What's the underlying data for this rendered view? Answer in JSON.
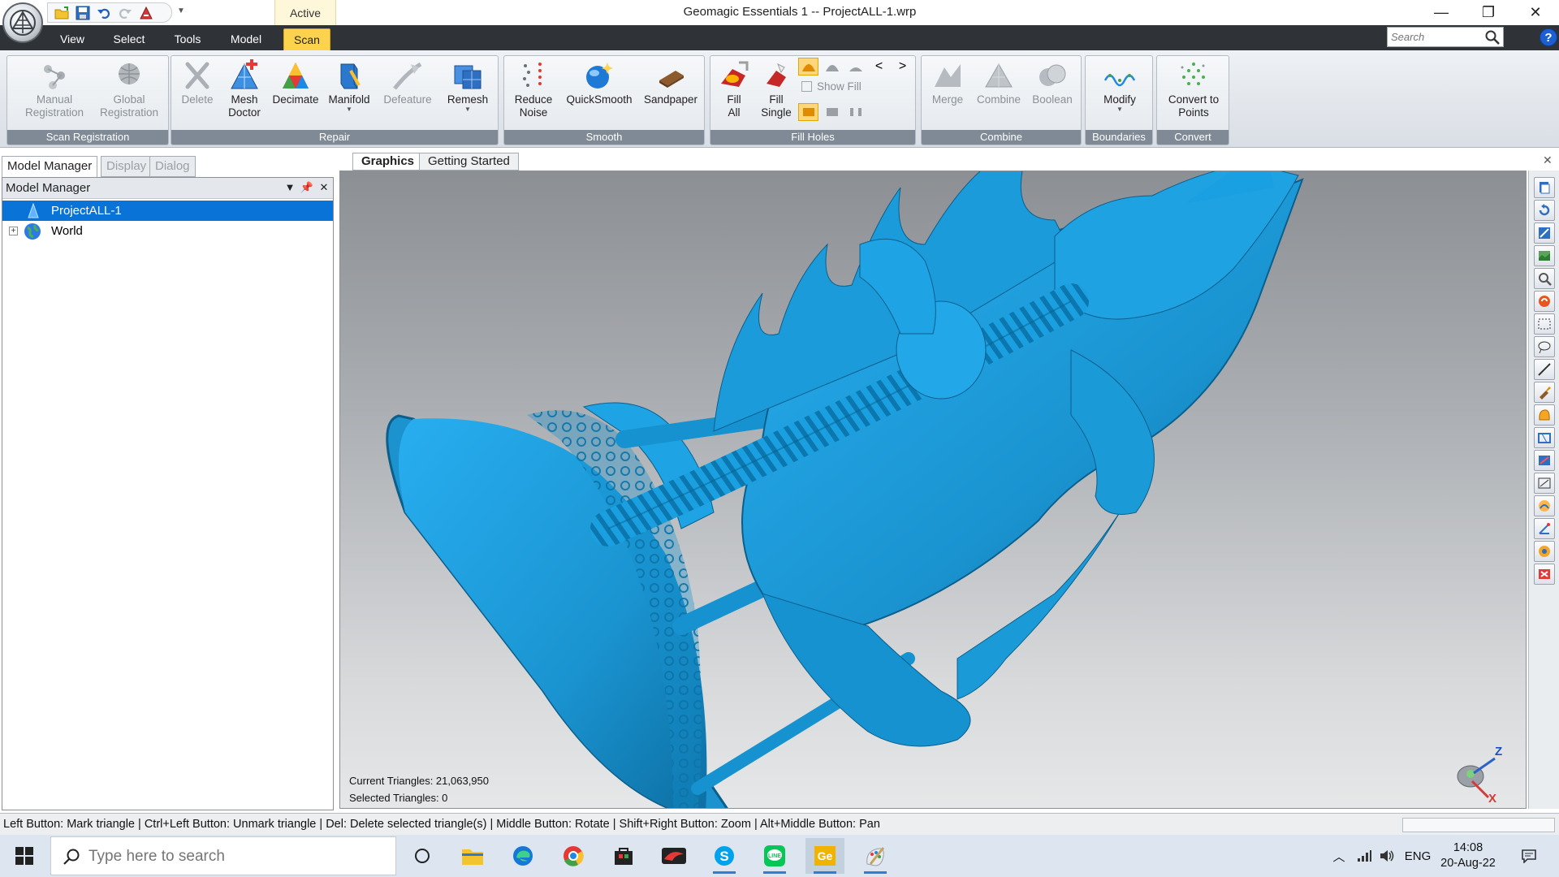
{
  "title_bar": {
    "active_label": "Active",
    "window_title": "Geomagic Essentials 1 -- ProjectALL-1.wrp",
    "minimize_glyph": "—",
    "maximize_glyph": "❐",
    "close_glyph": "✕"
  },
  "menu": {
    "tabs": [
      {
        "label": "View"
      },
      {
        "label": "Select"
      },
      {
        "label": "Tools"
      },
      {
        "label": "Model"
      },
      {
        "label": "Scan",
        "active": true
      }
    ],
    "search_placeholder": "Search",
    "help_label": "?"
  },
  "ribbon": {
    "groups": [
      {
        "label": "Scan Registration",
        "buttons": [
          {
            "label": "Manual\nRegistration",
            "enabled": false
          },
          {
            "label": "Global\nRegistration",
            "enabled": false
          }
        ]
      },
      {
        "label": "Repair",
        "buttons": [
          {
            "label": "Delete",
            "enabled": false
          },
          {
            "label": "Mesh\nDoctor",
            "enabled": true
          },
          {
            "label": "Decimate",
            "enabled": true
          },
          {
            "label": "Manifold",
            "enabled": true
          },
          {
            "label": "Defeature",
            "enabled": false
          },
          {
            "label": "Remesh",
            "enabled": true
          }
        ]
      },
      {
        "label": "Smooth",
        "buttons": [
          {
            "label": "Reduce\nNoise",
            "enabled": true
          },
          {
            "label": "QuickSmooth",
            "enabled": true
          },
          {
            "label": "Sandpaper",
            "enabled": true
          }
        ]
      },
      {
        "label": "Fill Holes",
        "buttons": [
          {
            "label": "Fill\nAll",
            "enabled": true
          },
          {
            "label": "Fill\nSingle",
            "enabled": true
          }
        ],
        "show_fill_label": "Show Fill"
      },
      {
        "label": "Combine",
        "buttons": [
          {
            "label": "Merge",
            "enabled": false
          },
          {
            "label": "Combine",
            "enabled": false
          },
          {
            "label": "Boolean",
            "enabled": false
          }
        ]
      },
      {
        "label": "Boundaries",
        "buttons": [
          {
            "label": "Modify",
            "enabled": true
          }
        ]
      },
      {
        "label": "Convert",
        "buttons": [
          {
            "label": "Convert to\nPoints",
            "enabled": true
          }
        ]
      }
    ]
  },
  "left_panel": {
    "tabs": [
      {
        "label": "Model Manager",
        "active": true
      },
      {
        "label": "Display",
        "active": false
      },
      {
        "label": "Dialog",
        "active": false
      }
    ],
    "header": "Model Manager",
    "tree": [
      {
        "label": "ProjectALL-1",
        "selected": true
      },
      {
        "label": "World",
        "selected": false,
        "expander": "+"
      }
    ]
  },
  "viewport": {
    "tabs": [
      {
        "label": "Graphics",
        "active": true
      },
      {
        "label": "Getting Started",
        "active": false
      }
    ],
    "current_triangles": "Current Triangles: 21,063,950",
    "selected_triangles": "Selected Triangles: 0",
    "axis_z": "Z",
    "axis_x": "X",
    "model_color": "#1a9ad6",
    "model_shadow": "#0b6d9e"
  },
  "status_bar": {
    "text": "Left Button: Mark triangle | Ctrl+Left Button: Unmark triangle | Del: Delete selected triangle(s) | Middle Button: Rotate | Shift+Right Button: Zoom | Alt+Middle Button: Pan"
  },
  "taskbar": {
    "search_placeholder": "Type here to search",
    "apps": [
      "task-view",
      "file-explorer",
      "edge",
      "chrome",
      "store",
      "red-app",
      "skype",
      "line",
      "geomagic",
      "paint"
    ],
    "language": "ENG",
    "time": "14:08",
    "date": "20-Aug-22"
  }
}
